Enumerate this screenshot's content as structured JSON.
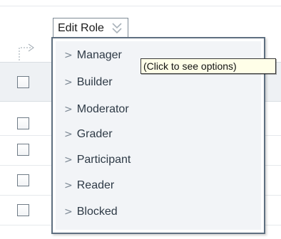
{
  "edit_role": {
    "label": "Edit Role"
  },
  "menu": {
    "items": [
      {
        "label": "Manager"
      },
      {
        "label": "Builder"
      },
      {
        "label": "Moderator"
      },
      {
        "label": "Grader"
      },
      {
        "label": "Participant"
      },
      {
        "label": "Reader"
      },
      {
        "label": "Blocked"
      }
    ],
    "caret": ">"
  },
  "tooltip": {
    "text": "(Click to see options)"
  }
}
